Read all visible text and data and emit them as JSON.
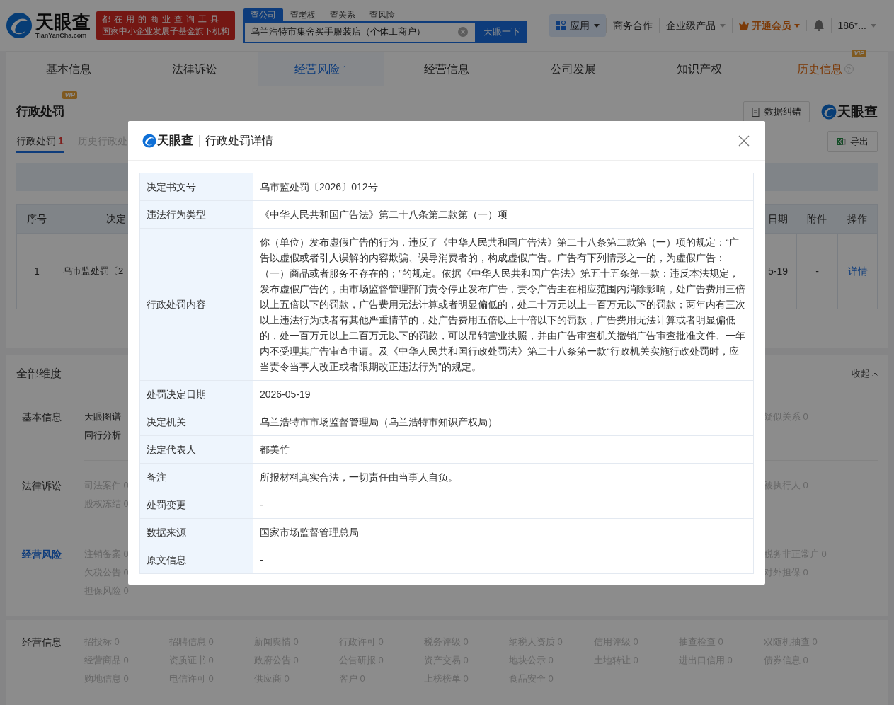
{
  "header": {
    "brand": "天眼查",
    "domain": "TianYanCha.com",
    "slogan": [
      "都在用的商业查询工具",
      "国家中小企业发展子基金旗下机构"
    ],
    "search": {
      "tabs": [
        {
          "label": "查公司",
          "selected": true
        },
        {
          "label": "查老板",
          "selected": false
        },
        {
          "label": "查关系",
          "selected": false
        },
        {
          "label": "查风险",
          "selected": false
        }
      ],
      "value": "乌兰浩特市集舍买手服装店（个体工商户）",
      "button": "天眼一下"
    },
    "nav": [
      {
        "kind": "apps",
        "label": "应用"
      },
      {
        "kind": "link",
        "label": "商务合作"
      },
      {
        "kind": "dropdown",
        "label": "企业级产品"
      },
      {
        "kind": "vip",
        "label": "开通会员"
      },
      {
        "kind": "bell"
      },
      {
        "kind": "dropdown",
        "label": "186*..."
      }
    ]
  },
  "tabs": [
    {
      "label": "基本信息",
      "selected": false
    },
    {
      "label": "法律诉讼",
      "selected": false
    },
    {
      "label": "经营风险",
      "count": "1",
      "selected": true
    },
    {
      "label": "经营信息",
      "selected": false
    },
    {
      "label": "公司发展",
      "selected": false
    },
    {
      "label": "知识产权",
      "selected": false
    },
    {
      "label": "历史信息",
      "badge": "VIP",
      "selected": false
    }
  ],
  "penalty_section": {
    "title": "行政处罚",
    "badge": "VIP",
    "feedback_button": "数据纠错",
    "brand": "天眼查",
    "subtabs": [
      {
        "label": "行政处罚",
        "count": "1",
        "selected": true
      },
      {
        "label": "历史行政处",
        "selected": false
      }
    ],
    "export_button": "导出",
    "table": {
      "columns": [
        "序号",
        "决定",
        "日期",
        "附件",
        "操作"
      ],
      "rows": [
        {
          "index": "1",
          "number": "乌市监处罚〔2",
          "date": "5-19",
          "attachment": "-",
          "action": "详情"
        }
      ]
    }
  },
  "dimensions": {
    "title": "全部维度",
    "collapse": "收起",
    "groups": [
      {
        "label": "基本信息",
        "selected": false,
        "left": [
          {
            "text": "天眼图谱",
            "enabled": true
          },
          {
            "text": "同行分析",
            "enabled": true
          }
        ],
        "right": [
          {
            "text": "疑似关系 0",
            "enabled": false
          }
        ]
      },
      {
        "label": "法律诉讼",
        "selected": false,
        "left": [
          {
            "text": "司法案件 0",
            "enabled": false
          },
          {
            "text": "股权冻结 0",
            "enabled": false
          }
        ],
        "right": [
          {
            "text": "被执行人 0",
            "enabled": false
          }
        ]
      },
      {
        "label": "经营风险",
        "selected": true,
        "left": [
          {
            "text": "注销备案 0",
            "enabled": false
          },
          {
            "text": "欠税公告 0",
            "enabled": false
          },
          {
            "text": "担保风险 0",
            "enabled": false
          }
        ],
        "right": [
          {
            "text": "税务非正常户 0",
            "enabled": false
          },
          {
            "text": "对外担保 0",
            "enabled": false
          }
        ]
      }
    ]
  },
  "business_info": {
    "label": "经营信息",
    "selected": false,
    "items": [
      {
        "text": "招投标 0",
        "enabled": false
      },
      {
        "text": "招聘信息 0",
        "enabled": false
      },
      {
        "text": "新闻舆情 0",
        "enabled": false
      },
      {
        "text": "行政许可 0",
        "enabled": false
      },
      {
        "text": "税务评级 0",
        "enabled": false
      },
      {
        "text": "纳税人资质 0",
        "enabled": false
      },
      {
        "text": "信用评级 0",
        "enabled": false
      },
      {
        "text": "抽查检查 0",
        "enabled": false
      },
      {
        "text": "双随机抽查 0",
        "enabled": false
      },
      {
        "text": "经营商品 0",
        "enabled": false
      },
      {
        "text": "资质证书 0",
        "enabled": false
      },
      {
        "text": "政府公告 0",
        "enabled": false
      },
      {
        "text": "公告研报 0",
        "enabled": false
      },
      {
        "text": "资产交易 0",
        "enabled": false
      },
      {
        "text": "地块公示 0",
        "enabled": false
      },
      {
        "text": "土地转让 0",
        "enabled": false
      },
      {
        "text": "进出口信用 0",
        "enabled": false
      },
      {
        "text": "债券信息 0",
        "enabled": false
      },
      {
        "text": "购地信息 0",
        "enabled": false
      },
      {
        "text": "电信许可 0",
        "enabled": false
      },
      {
        "text": "供应商 0",
        "enabled": false
      },
      {
        "text": "客户 0",
        "enabled": false
      },
      {
        "text": "上榜榜单 0",
        "enabled": false
      },
      {
        "text": "食品安全 0",
        "enabled": false
      }
    ]
  },
  "modal": {
    "brand": "天眼查",
    "title": "行政处罚详情",
    "rows": [
      {
        "label": "决定书文号",
        "value": "乌市监处罚〔2026〕012号"
      },
      {
        "label": "违法行为类型",
        "value": "《中华人民共和国广告法》第二十八条第二款第（一）项"
      },
      {
        "label": "行政处罚内容",
        "value": "你（单位）发布虚假广告的行为，违反了《中华人民共和国广告法》第二十八条第二款第（一）项的规定：“广告以虚假或者引人误解的内容欺骗、误导消费者的，构成虚假广告。广告有下列情形之一的，为虚假广告：（一）商品或者服务不存在的；”的规定。依据《中华人民共和国广告法》第五十五条第一款：违反本法规定，发布虚假广告的，由市场监督管理部门责令停止发布广告，责令广告主在相应范围内消除影响，处广告费用三倍以上五倍以下的罚款，广告费用无法计算或者明显偏低的，处二十万元以上一百万元以下的罚款；两年内有三次以上违法行为或者有其他严重情节的，处广告费用五倍以上十倍以下的罚款，广告费用无法计算或者明显偏低的，处一百万元以上二百万元以下的罚款，可以吊销营业执照，并由广告审查机关撤销广告审查批准文件、一年内不受理其广告审查申请。及《中华人民共和国行政处罚法》第二十八条第一款“行政机关实施行政处罚时，应当责令当事人改正或者限期改正违法行为”的规定。"
      },
      {
        "label": "处罚决定日期",
        "value": "2026-05-19"
      },
      {
        "label": "决定机关",
        "value": "乌兰浩特市市场监督管理局（乌兰浩特市知识产权局）"
      },
      {
        "label": "法定代表人",
        "value": "都美竹"
      },
      {
        "label": "备注",
        "value": "所报材料真实合法，一切责任由当事人自负。"
      },
      {
        "label": "处罚变更",
        "value": "-"
      },
      {
        "label": "数据来源",
        "value": "国家市场监督管理总局"
      },
      {
        "label": "原文信息",
        "value": "-"
      }
    ]
  }
}
